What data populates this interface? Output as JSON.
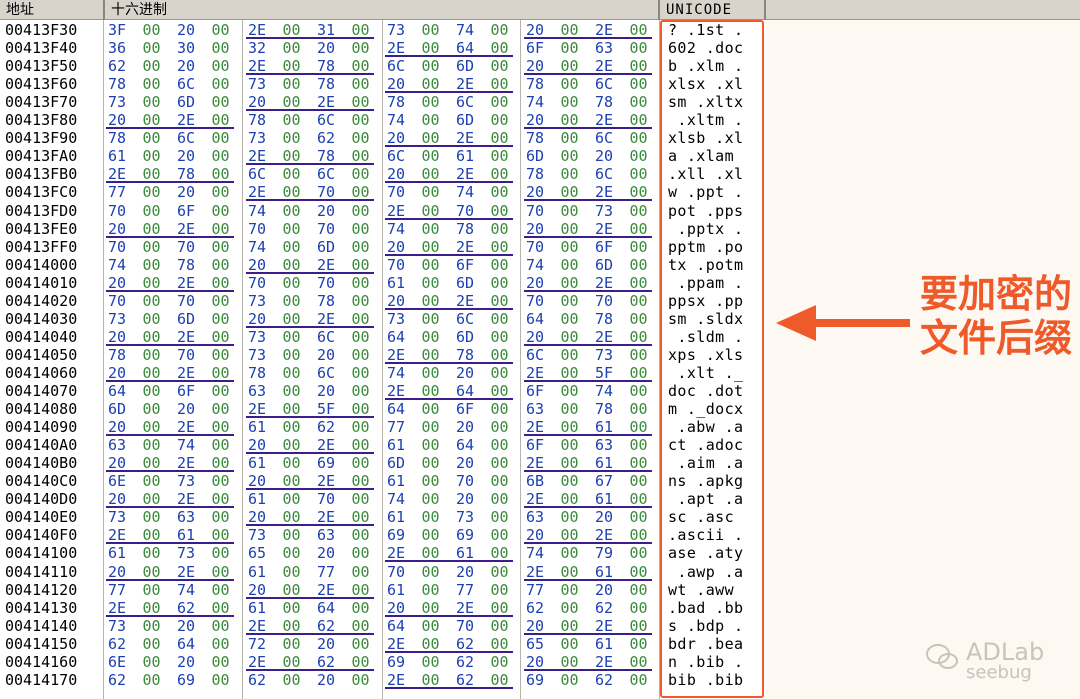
{
  "header": {
    "address": "地址",
    "hex": "十六进制",
    "unicode": "UNICODE"
  },
  "annotation": {
    "line1": "要加密的",
    "line2": "文件后缀"
  },
  "watermark": {
    "brand": "ADLab",
    "sub": "seebug"
  },
  "colors": {
    "highlight": "#f05a2a",
    "hex_high": "#1d3fb0",
    "hex_low": "#3a8a3a",
    "underline": "#3a1f8a"
  },
  "rows": [
    {
      "addr": "00413F30",
      "bytes": [
        "3F",
        "00",
        "20",
        "00",
        "2E",
        "00",
        "31",
        "00",
        "73",
        "00",
        "74",
        "00",
        "20",
        "00",
        "2E",
        "00"
      ],
      "text": "? .1st ."
    },
    {
      "addr": "00413F40",
      "bytes": [
        "36",
        "00",
        "30",
        "00",
        "32",
        "00",
        "20",
        "00",
        "2E",
        "00",
        "64",
        "00",
        "6F",
        "00",
        "63",
        "00"
      ],
      "text": "602 .doc"
    },
    {
      "addr": "00413F50",
      "bytes": [
        "62",
        "00",
        "20",
        "00",
        "2E",
        "00",
        "78",
        "00",
        "6C",
        "00",
        "6D",
        "00",
        "20",
        "00",
        "2E",
        "00"
      ],
      "text": "b .xlm ."
    },
    {
      "addr": "00413F60",
      "bytes": [
        "78",
        "00",
        "6C",
        "00",
        "73",
        "00",
        "78",
        "00",
        "20",
        "00",
        "2E",
        "00",
        "78",
        "00",
        "6C",
        "00"
      ],
      "text": "xlsx .xl"
    },
    {
      "addr": "00413F70",
      "bytes": [
        "73",
        "00",
        "6D",
        "00",
        "20",
        "00",
        "2E",
        "00",
        "78",
        "00",
        "6C",
        "00",
        "74",
        "00",
        "78",
        "00"
      ],
      "text": "sm .xltx"
    },
    {
      "addr": "00413F80",
      "bytes": [
        "20",
        "00",
        "2E",
        "00",
        "78",
        "00",
        "6C",
        "00",
        "74",
        "00",
        "6D",
        "00",
        "20",
        "00",
        "2E",
        "00"
      ],
      "text": " .xltm ."
    },
    {
      "addr": "00413F90",
      "bytes": [
        "78",
        "00",
        "6C",
        "00",
        "73",
        "00",
        "62",
        "00",
        "20",
        "00",
        "2E",
        "00",
        "78",
        "00",
        "6C",
        "00"
      ],
      "text": "xlsb .xl"
    },
    {
      "addr": "00413FA0",
      "bytes": [
        "61",
        "00",
        "20",
        "00",
        "2E",
        "00",
        "78",
        "00",
        "6C",
        "00",
        "61",
        "00",
        "6D",
        "00",
        "20",
        "00"
      ],
      "text": "a .xlam "
    },
    {
      "addr": "00413FB0",
      "bytes": [
        "2E",
        "00",
        "78",
        "00",
        "6C",
        "00",
        "6C",
        "00",
        "20",
        "00",
        "2E",
        "00",
        "78",
        "00",
        "6C",
        "00"
      ],
      "text": ".xll .xl"
    },
    {
      "addr": "00413FC0",
      "bytes": [
        "77",
        "00",
        "20",
        "00",
        "2E",
        "00",
        "70",
        "00",
        "70",
        "00",
        "74",
        "00",
        "20",
        "00",
        "2E",
        "00"
      ],
      "text": "w .ppt ."
    },
    {
      "addr": "00413FD0",
      "bytes": [
        "70",
        "00",
        "6F",
        "00",
        "74",
        "00",
        "20",
        "00",
        "2E",
        "00",
        "70",
        "00",
        "70",
        "00",
        "73",
        "00"
      ],
      "text": "pot .pps"
    },
    {
      "addr": "00413FE0",
      "bytes": [
        "20",
        "00",
        "2E",
        "00",
        "70",
        "00",
        "70",
        "00",
        "74",
        "00",
        "78",
        "00",
        "20",
        "00",
        "2E",
        "00"
      ],
      "text": " .pptx ."
    },
    {
      "addr": "00413FF0",
      "bytes": [
        "70",
        "00",
        "70",
        "00",
        "74",
        "00",
        "6D",
        "00",
        "20",
        "00",
        "2E",
        "00",
        "70",
        "00",
        "6F",
        "00"
      ],
      "text": "pptm .po"
    },
    {
      "addr": "00414000",
      "bytes": [
        "74",
        "00",
        "78",
        "00",
        "20",
        "00",
        "2E",
        "00",
        "70",
        "00",
        "6F",
        "00",
        "74",
        "00",
        "6D",
        "00"
      ],
      "text": "tx .potm"
    },
    {
      "addr": "00414010",
      "bytes": [
        "20",
        "00",
        "2E",
        "00",
        "70",
        "00",
        "70",
        "00",
        "61",
        "00",
        "6D",
        "00",
        "20",
        "00",
        "2E",
        "00"
      ],
      "text": " .ppam ."
    },
    {
      "addr": "00414020",
      "bytes": [
        "70",
        "00",
        "70",
        "00",
        "73",
        "00",
        "78",
        "00",
        "20",
        "00",
        "2E",
        "00",
        "70",
        "00",
        "70",
        "00"
      ],
      "text": "ppsx .pp"
    },
    {
      "addr": "00414030",
      "bytes": [
        "73",
        "00",
        "6D",
        "00",
        "20",
        "00",
        "2E",
        "00",
        "73",
        "00",
        "6C",
        "00",
        "64",
        "00",
        "78",
        "00"
      ],
      "text": "sm .sldx"
    },
    {
      "addr": "00414040",
      "bytes": [
        "20",
        "00",
        "2E",
        "00",
        "73",
        "00",
        "6C",
        "00",
        "64",
        "00",
        "6D",
        "00",
        "20",
        "00",
        "2E",
        "00"
      ],
      "text": " .sldm ."
    },
    {
      "addr": "00414050",
      "bytes": [
        "78",
        "00",
        "70",
        "00",
        "73",
        "00",
        "20",
        "00",
        "2E",
        "00",
        "78",
        "00",
        "6C",
        "00",
        "73",
        "00"
      ],
      "text": "xps .xls"
    },
    {
      "addr": "00414060",
      "bytes": [
        "20",
        "00",
        "2E",
        "00",
        "78",
        "00",
        "6C",
        "00",
        "74",
        "00",
        "20",
        "00",
        "2E",
        "00",
        "5F",
        "00"
      ],
      "text": " .xlt ._"
    },
    {
      "addr": "00414070",
      "bytes": [
        "64",
        "00",
        "6F",
        "00",
        "63",
        "00",
        "20",
        "00",
        "2E",
        "00",
        "64",
        "00",
        "6F",
        "00",
        "74",
        "00"
      ],
      "text": "doc .dot"
    },
    {
      "addr": "00414080",
      "bytes": [
        "6D",
        "00",
        "20",
        "00",
        "2E",
        "00",
        "5F",
        "00",
        "64",
        "00",
        "6F",
        "00",
        "63",
        "00",
        "78",
        "00"
      ],
      "text": "m ._docx"
    },
    {
      "addr": "00414090",
      "bytes": [
        "20",
        "00",
        "2E",
        "00",
        "61",
        "00",
        "62",
        "00",
        "77",
        "00",
        "20",
        "00",
        "2E",
        "00",
        "61",
        "00"
      ],
      "text": " .abw .a"
    },
    {
      "addr": "004140A0",
      "bytes": [
        "63",
        "00",
        "74",
        "00",
        "20",
        "00",
        "2E",
        "00",
        "61",
        "00",
        "64",
        "00",
        "6F",
        "00",
        "63",
        "00"
      ],
      "text": "ct .adoc"
    },
    {
      "addr": "004140B0",
      "bytes": [
        "20",
        "00",
        "2E",
        "00",
        "61",
        "00",
        "69",
        "00",
        "6D",
        "00",
        "20",
        "00",
        "2E",
        "00",
        "61",
        "00"
      ],
      "text": " .aim .a"
    },
    {
      "addr": "004140C0",
      "bytes": [
        "6E",
        "00",
        "73",
        "00",
        "20",
        "00",
        "2E",
        "00",
        "61",
        "00",
        "70",
        "00",
        "6B",
        "00",
        "67",
        "00"
      ],
      "text": "ns .apkg"
    },
    {
      "addr": "004140D0",
      "bytes": [
        "20",
        "00",
        "2E",
        "00",
        "61",
        "00",
        "70",
        "00",
        "74",
        "00",
        "20",
        "00",
        "2E",
        "00",
        "61",
        "00"
      ],
      "text": " .apt .a"
    },
    {
      "addr": "004140E0",
      "bytes": [
        "73",
        "00",
        "63",
        "00",
        "20",
        "00",
        "2E",
        "00",
        "61",
        "00",
        "73",
        "00",
        "63",
        "00",
        "20",
        "00"
      ],
      "text": "sc .asc "
    },
    {
      "addr": "004140F0",
      "bytes": [
        "2E",
        "00",
        "61",
        "00",
        "73",
        "00",
        "63",
        "00",
        "69",
        "00",
        "69",
        "00",
        "20",
        "00",
        "2E",
        "00"
      ],
      "text": ".ascii ."
    },
    {
      "addr": "00414100",
      "bytes": [
        "61",
        "00",
        "73",
        "00",
        "65",
        "00",
        "20",
        "00",
        "2E",
        "00",
        "61",
        "00",
        "74",
        "00",
        "79",
        "00"
      ],
      "text": "ase .aty"
    },
    {
      "addr": "00414110",
      "bytes": [
        "20",
        "00",
        "2E",
        "00",
        "61",
        "00",
        "77",
        "00",
        "70",
        "00",
        "20",
        "00",
        "2E",
        "00",
        "61",
        "00"
      ],
      "text": " .awp .a"
    },
    {
      "addr": "00414120",
      "bytes": [
        "77",
        "00",
        "74",
        "00",
        "20",
        "00",
        "2E",
        "00",
        "61",
        "00",
        "77",
        "00",
        "77",
        "00",
        "20",
        "00"
      ],
      "text": "wt .aww "
    },
    {
      "addr": "00414130",
      "bytes": [
        "2E",
        "00",
        "62",
        "00",
        "61",
        "00",
        "64",
        "00",
        "20",
        "00",
        "2E",
        "00",
        "62",
        "00",
        "62",
        "00"
      ],
      "text": ".bad .bb"
    },
    {
      "addr": "00414140",
      "bytes": [
        "73",
        "00",
        "20",
        "00",
        "2E",
        "00",
        "62",
        "00",
        "64",
        "00",
        "70",
        "00",
        "20",
        "00",
        "2E",
        "00"
      ],
      "text": "s .bdp ."
    },
    {
      "addr": "00414150",
      "bytes": [
        "62",
        "00",
        "64",
        "00",
        "72",
        "00",
        "20",
        "00",
        "2E",
        "00",
        "62",
        "00",
        "65",
        "00",
        "61",
        "00"
      ],
      "text": "bdr .bea"
    },
    {
      "addr": "00414160",
      "bytes": [
        "6E",
        "00",
        "20",
        "00",
        "2E",
        "00",
        "62",
        "00",
        "69",
        "00",
        "62",
        "00",
        "20",
        "00",
        "2E",
        "00"
      ],
      "text": "n .bib ."
    },
    {
      "addr": "00414170",
      "bytes": [
        "62",
        "00",
        "69",
        "00",
        "62",
        "00",
        "20",
        "00",
        "2E",
        "00",
        "62",
        "00",
        "69",
        "00",
        "62",
        "00"
      ],
      "text": "bib .bib"
    }
  ]
}
